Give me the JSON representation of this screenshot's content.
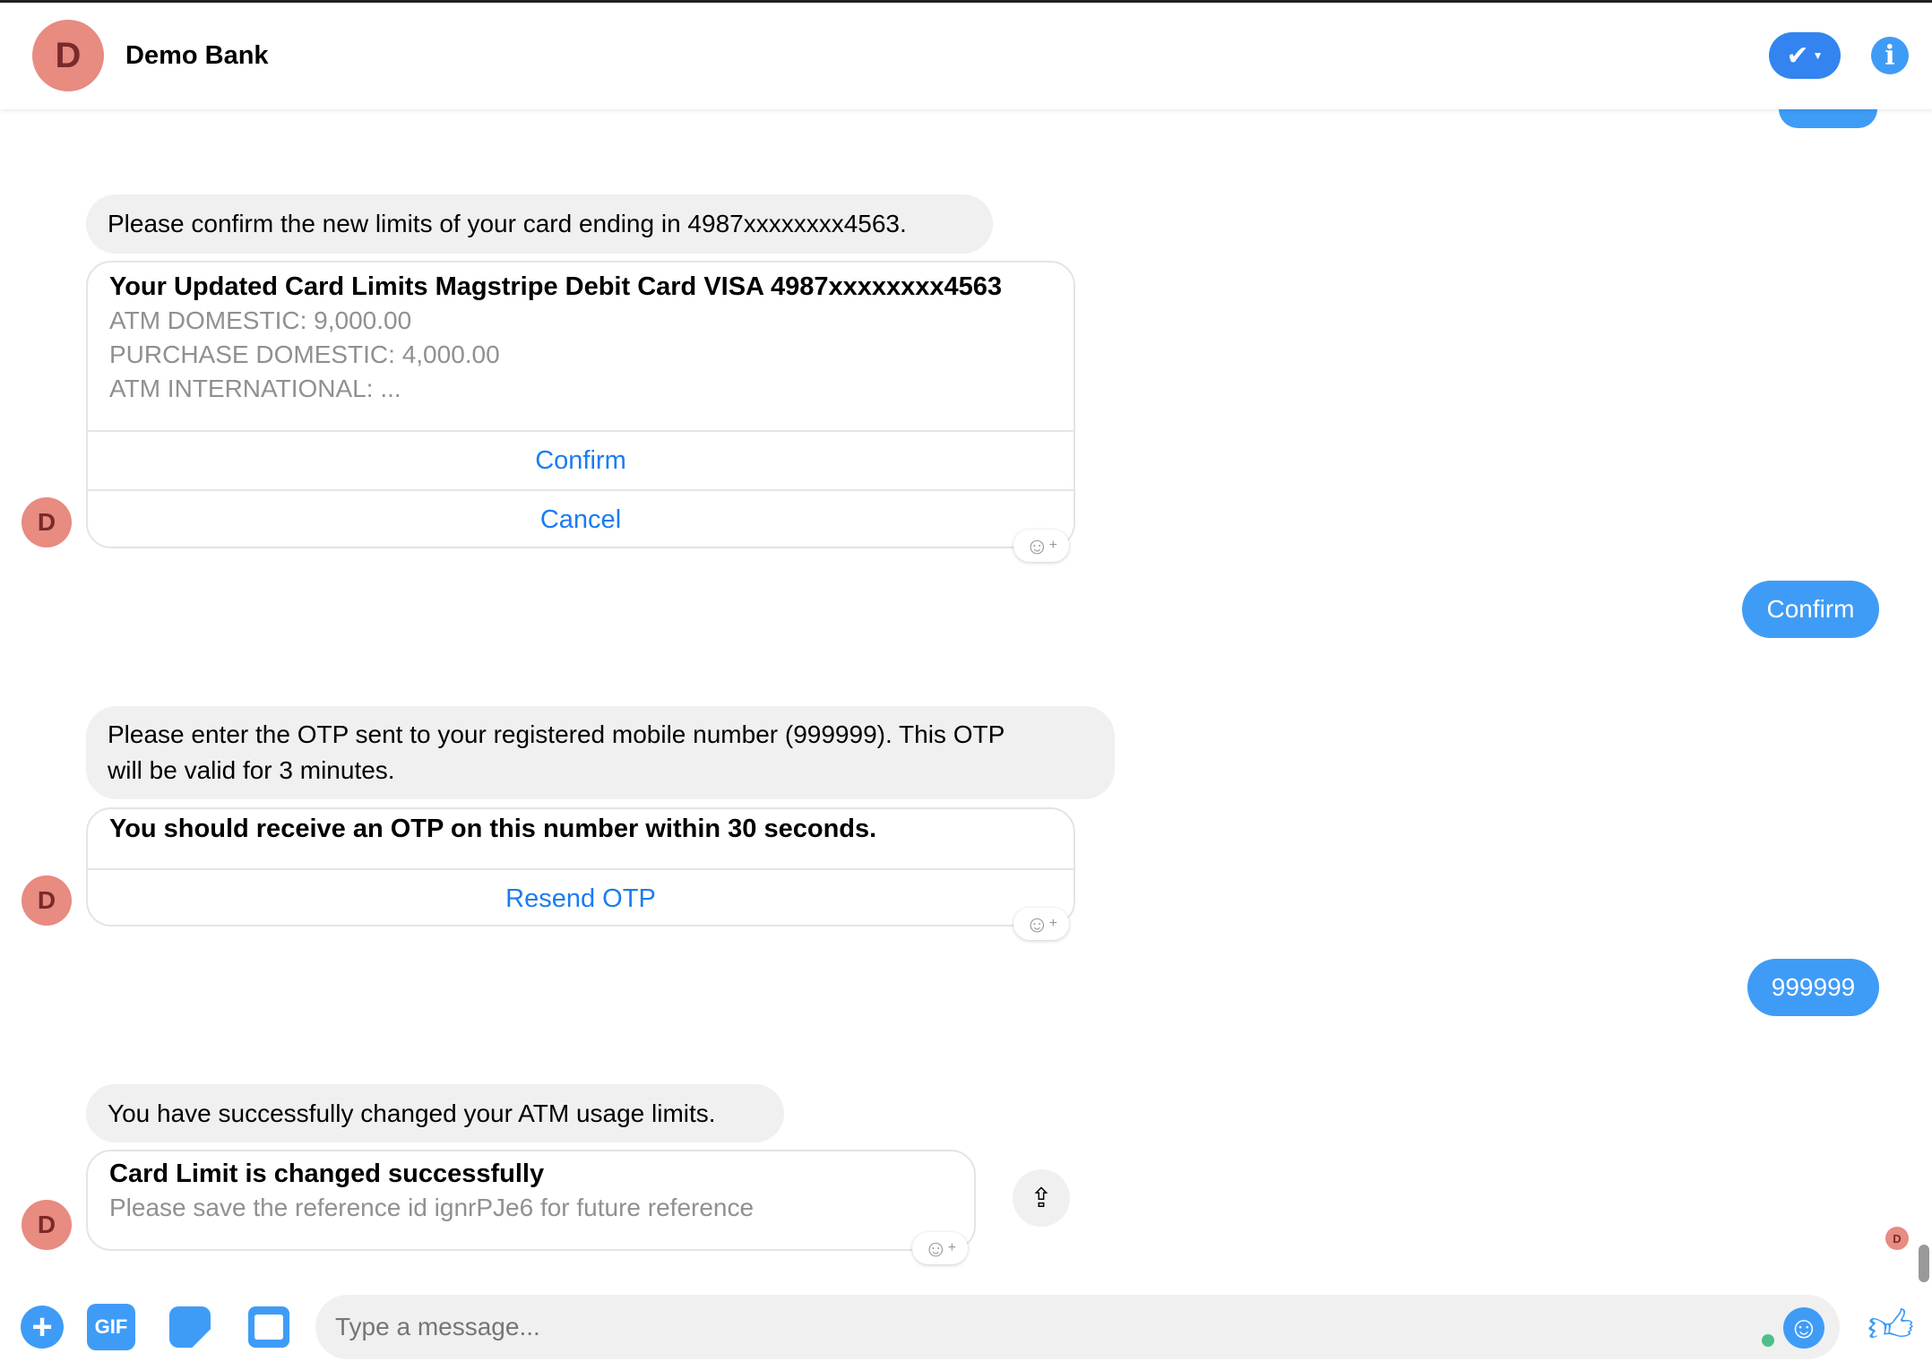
{
  "header": {
    "avatar_letter": "D",
    "title": "Demo Bank"
  },
  "messages": [
    {
      "text": "Please confirm the new limits of your card ending in 4987xxxxxxxx4563.",
      "card": {
        "title": "Your Updated Card Limits Magstripe Debit Card VISA 4987xxxxxxxx4563",
        "lines": [
          "ATM DOMESTIC: 9,000.00",
          "PURCHASE DOMESTIC: 4,000.00",
          "ATM INTERNATIONAL: ..."
        ],
        "buttons": [
          "Confirm",
          "Cancel"
        ]
      }
    },
    {
      "user_reply": "Confirm"
    },
    {
      "text_lines": [
        "Please enter the OTP sent to your registered mobile number (999999). This OTP",
        "will be valid for 3 minutes."
      ],
      "card": {
        "title": "You should receive an OTP on this number within 30 seconds.",
        "buttons": [
          "Resend OTP"
        ]
      }
    },
    {
      "user_reply": "999999"
    },
    {
      "text": "You have successfully changed your ATM usage limits.",
      "card": {
        "title": "Card Limit is changed successfully",
        "subtitle": "Please save the reference id ignrPJe6 for future reference"
      }
    }
  ],
  "avatar_letter": "D",
  "composer": {
    "placeholder": "Type a message...",
    "gif_label": "GIF"
  },
  "colors": {
    "accent": "#3f9cf6",
    "avatar": "#e88b80"
  }
}
